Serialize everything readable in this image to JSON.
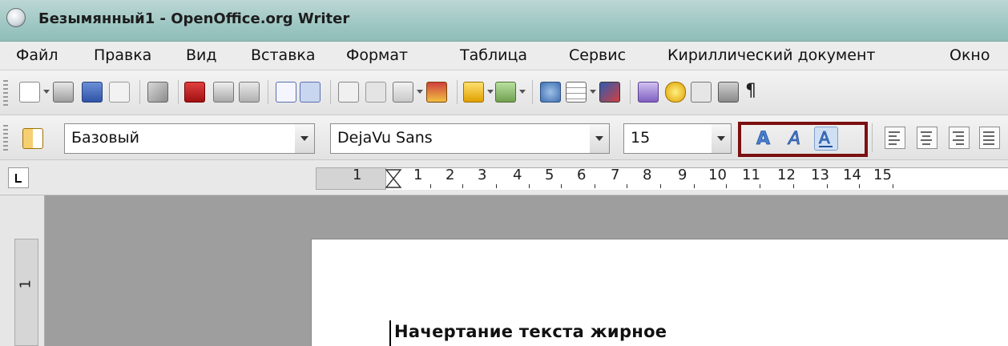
{
  "window": {
    "title": "Безымянный1 - OpenOffice.org Writer"
  },
  "menu": {
    "items": [
      {
        "label": "Файл"
      },
      {
        "label": "Правка"
      },
      {
        "label": "Вид"
      },
      {
        "label": "Вставка"
      },
      {
        "label": "Формат"
      },
      {
        "label": "Таблица"
      },
      {
        "label": "Сервис"
      },
      {
        "label": "Кириллический документ"
      },
      {
        "label": "Окно"
      }
    ]
  },
  "toolbar_standard": {
    "icons": [
      "new-document-icon",
      "templates-icon",
      "save-icon",
      "email-icon",
      "edit-file-icon",
      "export-pdf-icon",
      "print-icon",
      "page-preview-icon",
      "spellcheck-icon",
      "autospellcheck-icon",
      "cut-icon",
      "copy-icon",
      "paste-icon",
      "format-paintbrush-icon",
      "undo-icon",
      "redo-icon",
      "hyperlink-icon",
      "table-icon",
      "draw-functions-icon",
      "find-replace-icon",
      "navigator-icon",
      "gallery-icon",
      "data-sources-icon",
      "formatting-marks-icon"
    ]
  },
  "toolbar_formatting": {
    "paragraph_style": "Базовый",
    "font_name": "DejaVu Sans",
    "font_size": "15",
    "styles": [
      "bold-icon",
      "italic-icon",
      "underline-icon"
    ],
    "highlight_color": "#7b1010"
  },
  "ruler": {
    "labels": [
      "1",
      "1",
      "2",
      "3",
      "4",
      "5",
      "6",
      "7",
      "8",
      "9",
      "10",
      "11",
      "12",
      "13",
      "14",
      "15"
    ]
  },
  "vertical_ruler": {
    "label": "1"
  },
  "document": {
    "text": "Начертание текста жирное"
  }
}
